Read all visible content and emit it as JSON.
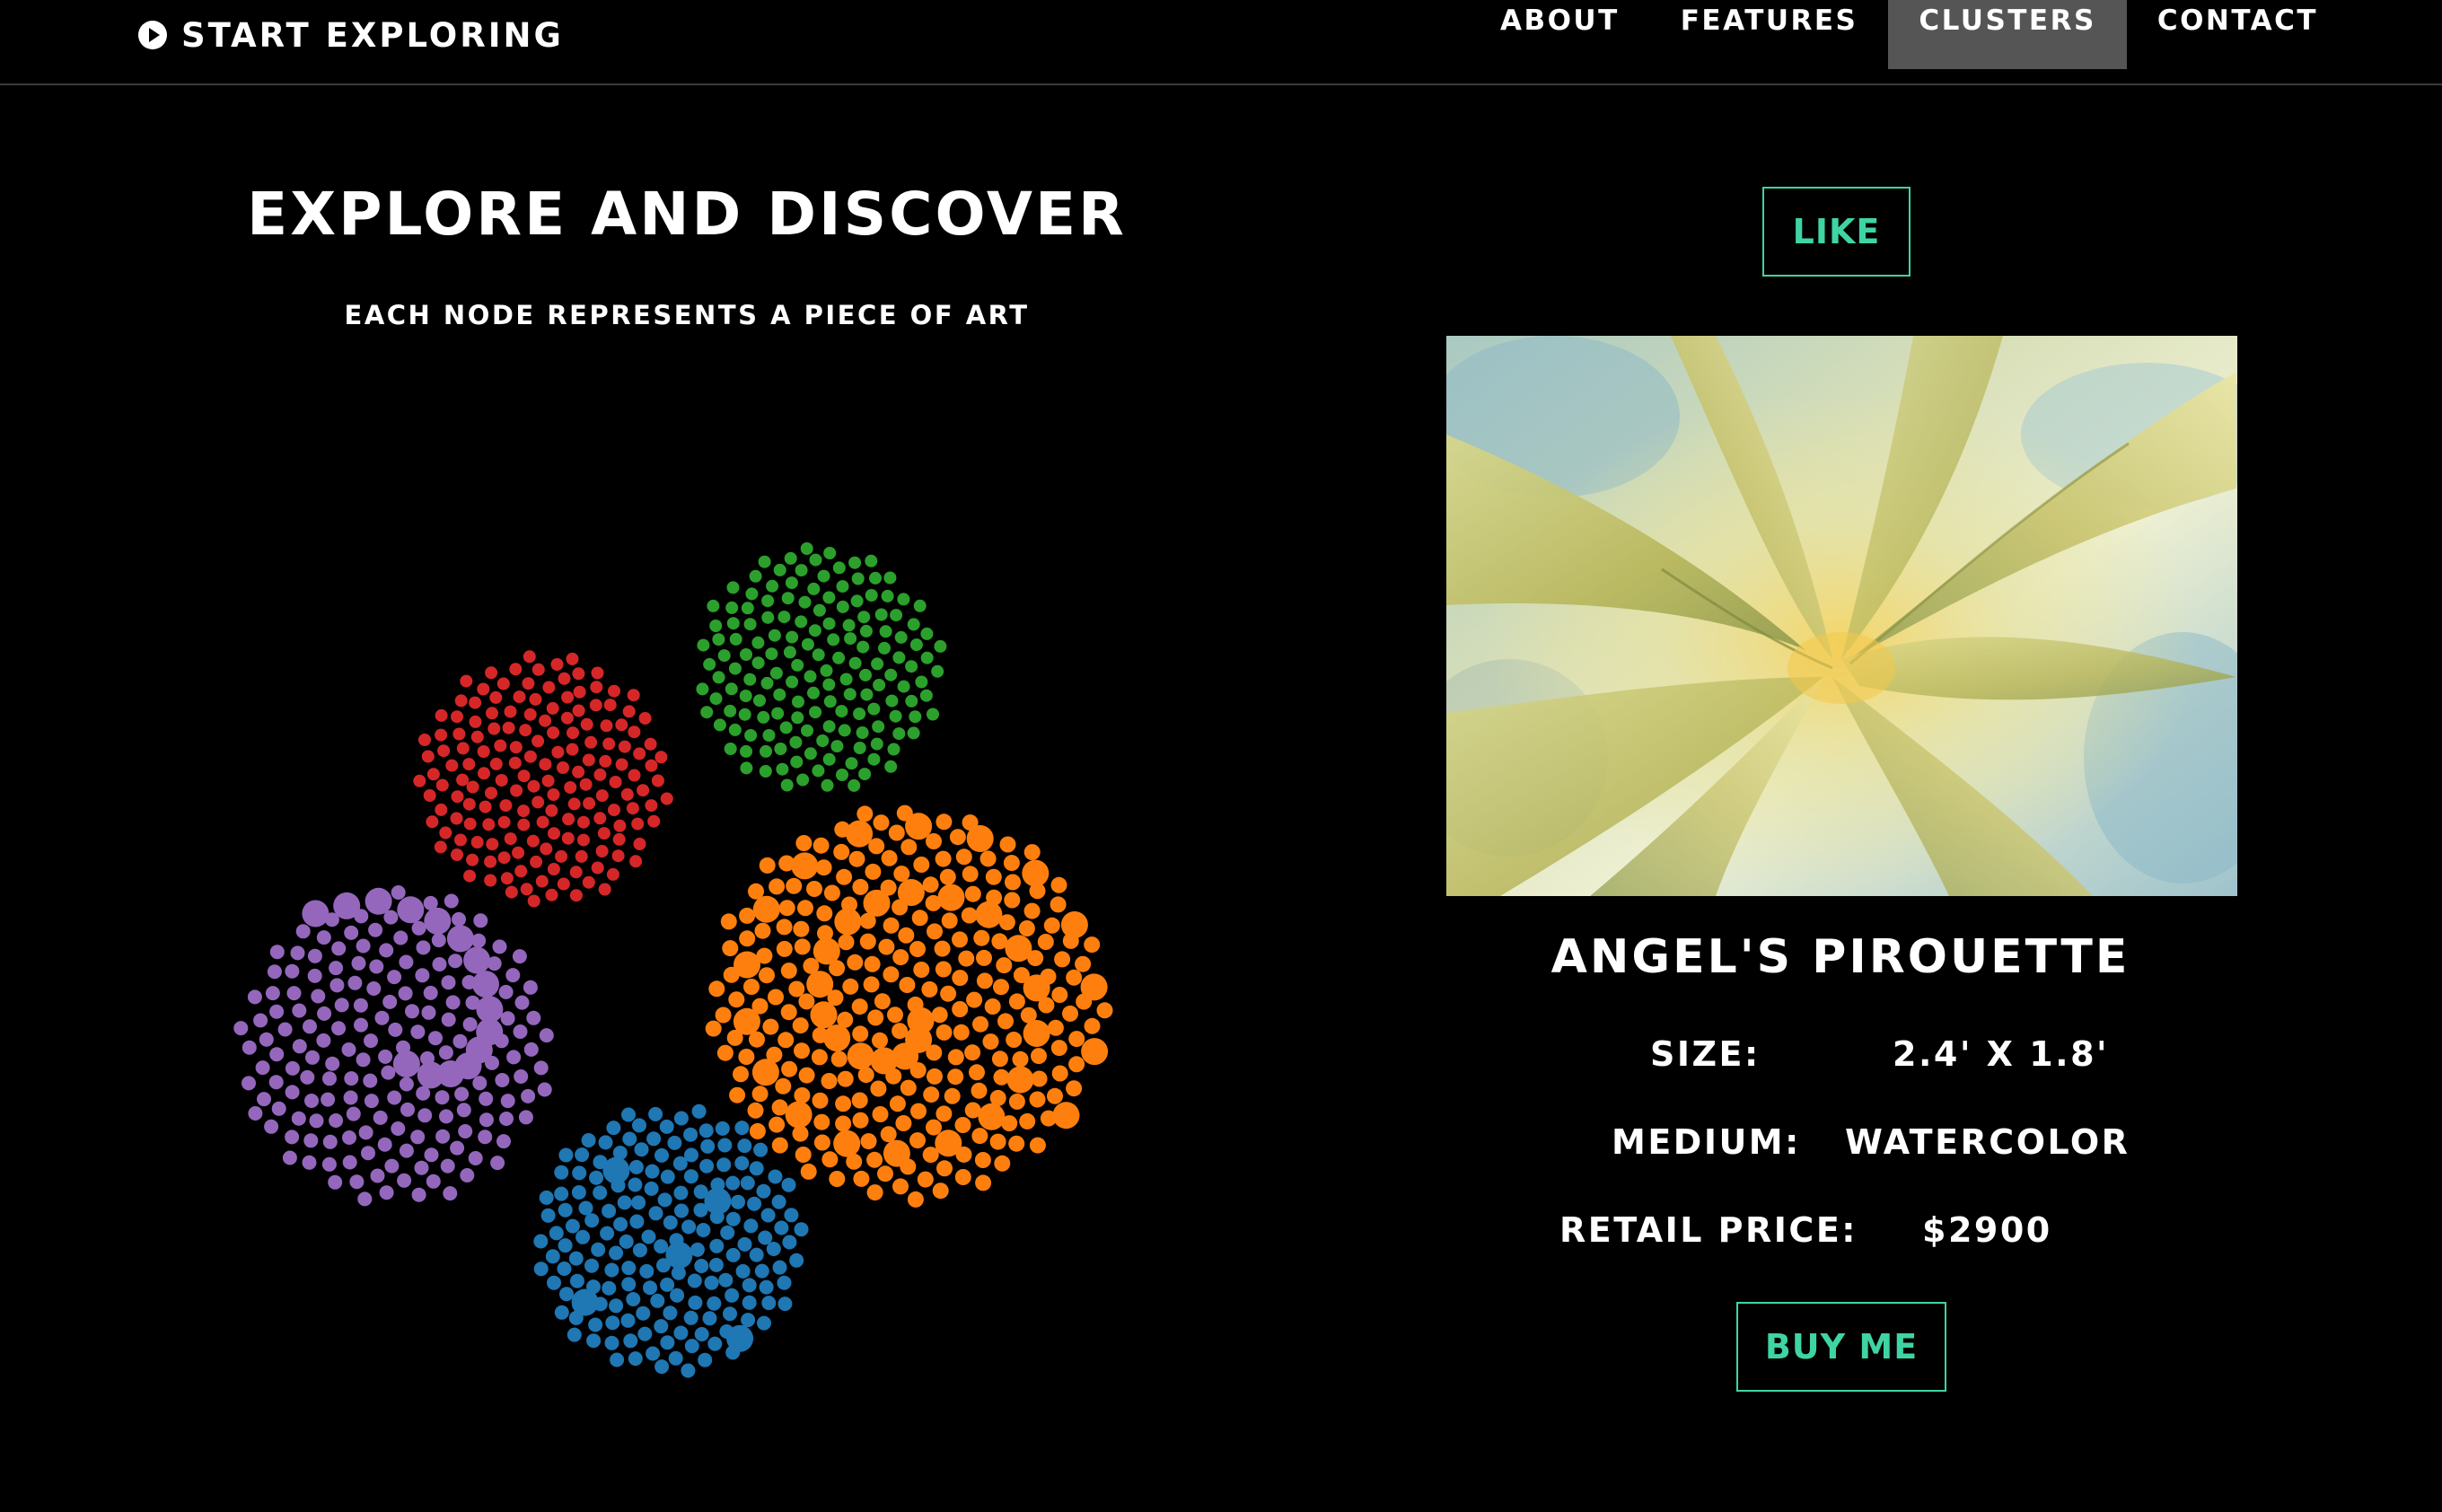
{
  "nav": {
    "brand": "START EXPLORING",
    "items": [
      {
        "label": "ABOUT"
      },
      {
        "label": "FEATURES"
      },
      {
        "label": "CLUSTERS"
      },
      {
        "label": "CONTACT"
      }
    ],
    "active": "CLUSTERS"
  },
  "explore": {
    "title": "EXPLORE AND DISCOVER",
    "subtitle": "EACH NODE REPRESENTS A PIECE OF ART",
    "clusters": [
      {
        "name": "red",
        "color": "#d62728",
        "node_count": 170
      },
      {
        "name": "green",
        "color": "#2ca02c",
        "node_count": 160
      },
      {
        "name": "orange",
        "color": "#ff7f0e",
        "node_count": 290
      },
      {
        "name": "purple",
        "color": "#9467bd",
        "node_count": 190
      },
      {
        "name": "blue",
        "color": "#1f77b4",
        "node_count": 180
      }
    ]
  },
  "detail": {
    "like_label": "LIKE",
    "artwork_icon": "leaf-painting-image",
    "title": "ANGEL'S PIROUETTE",
    "specs": [
      {
        "label": "SIZE:",
        "value": "2.4' X 1.8'"
      },
      {
        "label": "MEDIUM:",
        "value": "WATERCOLOR"
      },
      {
        "label": "RETAIL PRICE:",
        "value": "$2900"
      }
    ],
    "buy_label": "BUY ME"
  },
  "colors": {
    "accent": "#3fd4a4",
    "background": "#000000",
    "nav_active": "#555555"
  }
}
